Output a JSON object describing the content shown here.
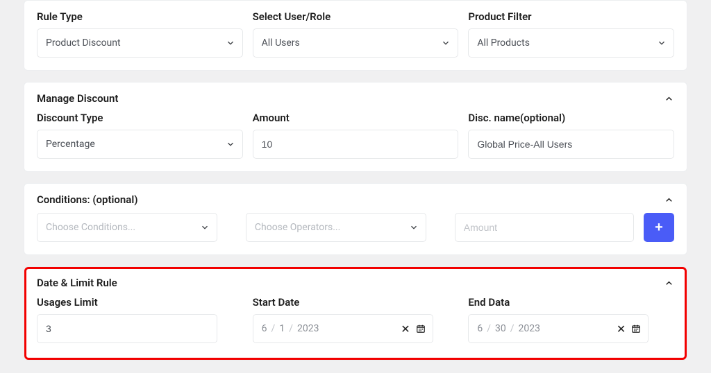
{
  "top": {
    "rule_type": {
      "label": "Rule Type",
      "value": "Product Discount"
    },
    "user_role": {
      "label": "Select User/Role",
      "value": "All Users"
    },
    "product_filter": {
      "label": "Product Filter",
      "value": "All Products"
    }
  },
  "discount": {
    "heading": "Manage Discount",
    "type": {
      "label": "Discount Type",
      "value": "Percentage"
    },
    "amount": {
      "label": "Amount",
      "value": "10"
    },
    "name": {
      "label": "Disc. name(optional)",
      "value": "Global Price-All Users"
    }
  },
  "conditions": {
    "heading": "Conditions: (optional)",
    "condition_placeholder": "Choose Conditions...",
    "operator_placeholder": "Choose Operators...",
    "amount_placeholder": "Amount",
    "add_symbol": "+"
  },
  "dates": {
    "heading": "Date & Limit Rule",
    "usage_label": "Usages Limit",
    "usage_value": "3",
    "start_label": "Start Date",
    "start": {
      "m": "6",
      "d": "1",
      "y": "2023"
    },
    "end_label": "End Data",
    "end": {
      "m": "6",
      "d": "30",
      "y": "2023"
    },
    "slash": "/",
    "clear_glyph": "✕"
  }
}
